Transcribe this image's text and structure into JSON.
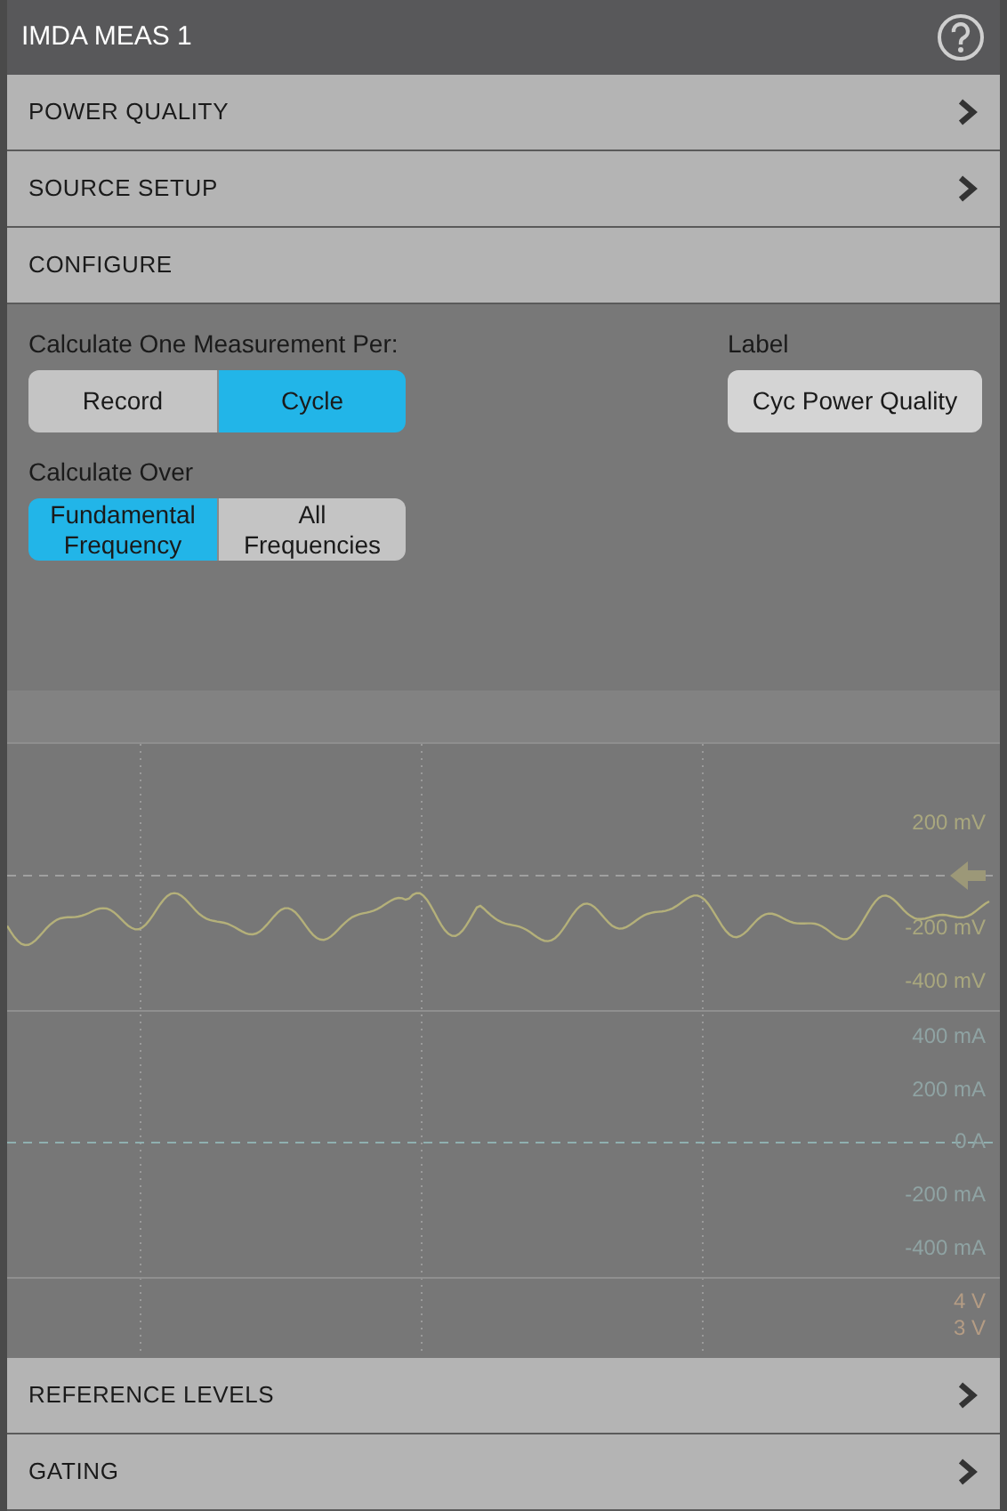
{
  "header": {
    "title": "IMDA MEAS 1"
  },
  "sections_top": [
    {
      "label": "POWER QUALITY",
      "expanded": false
    },
    {
      "label": "SOURCE SETUP",
      "expanded": false
    },
    {
      "label": "CONFIGURE",
      "expanded": true
    }
  ],
  "configure": {
    "measure_per": {
      "label": "Calculate One Measurement Per:",
      "options": [
        {
          "label": "Record",
          "selected": false
        },
        {
          "label": "Cycle",
          "selected": true
        }
      ]
    },
    "label_field": {
      "label": "Label",
      "value": "Cyc Power Quality"
    },
    "calculate_over": {
      "label": "Calculate Over",
      "options": [
        {
          "label": "Fundamental Frequency",
          "selected": true
        },
        {
          "label": "All Frequencies",
          "selected": false
        }
      ]
    }
  },
  "scope": {
    "scale_labels": [
      {
        "text": "200 mV",
        "color": "#a9a77e"
      },
      {
        "text": "-200 mV",
        "color": "#a9a77e"
      },
      {
        "text": "-400 mV",
        "color": "#a9a77e"
      },
      {
        "text": "400 mA",
        "color": "#8fa3a3"
      },
      {
        "text": "200 mA",
        "color": "#8fa3a3"
      },
      {
        "text": "0 A",
        "color": "#8fa3a3"
      },
      {
        "text": "-200 mA",
        "color": "#8fa3a3"
      },
      {
        "text": "-400 mA",
        "color": "#8fa3a3"
      },
      {
        "text": "4 V",
        "color": "#b49c84"
      },
      {
        "text": "3 V",
        "color": "#b49c84"
      }
    ]
  },
  "sections_bottom": [
    {
      "label": "REFERENCE LEVELS",
      "expanded": false
    },
    {
      "label": "GATING",
      "expanded": false
    }
  ]
}
